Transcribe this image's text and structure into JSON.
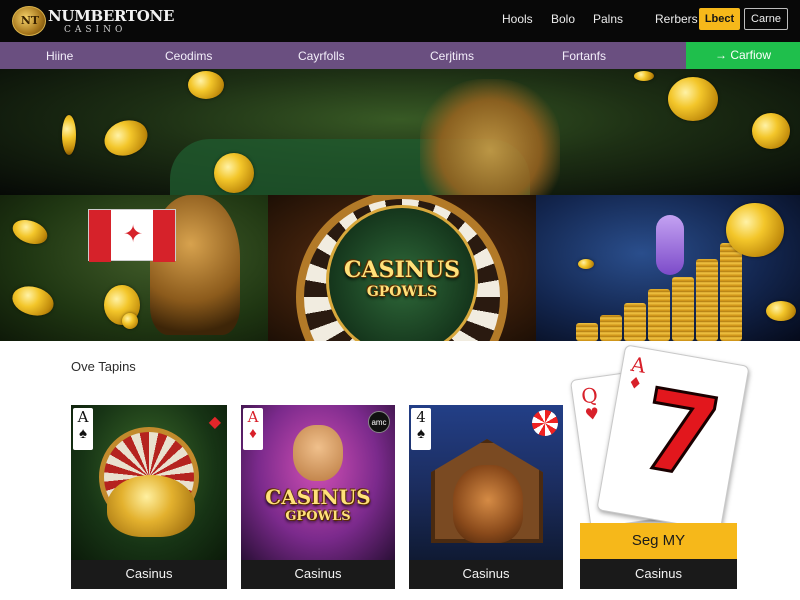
{
  "header": {
    "logo_name": "NUMBERTONE",
    "logo_sub": "CASINO",
    "logo_badge": "NT",
    "nav": [
      "Hools",
      "Bolo",
      "Palns",
      "Rerbers"
    ],
    "login_label": "Lbect",
    "casino_label": "Carne"
  },
  "mainnav": {
    "items": [
      "Hiine",
      "Ceodims",
      "Cayrfolls",
      "Cerjtims",
      "Fortanfs"
    ],
    "cta_label": "→ Carfiow"
  },
  "banners": {
    "center_logo_line1": "CASINUS",
    "center_logo_line2": "GPOWLS"
  },
  "section": {
    "title": "Ove Tapins"
  },
  "cards": [
    {
      "label": "Casinus",
      "corner_rank": "A",
      "corner_suit": "♠"
    },
    {
      "label": "Casinus",
      "corner_rank": "A",
      "corner_suit": "♦",
      "badge": "amc",
      "logo_line1": "CASINUS",
      "logo_line2": "GPOWLS"
    },
    {
      "label": "Casinus",
      "corner_rank": "4",
      "corner_suit": "♠"
    }
  ],
  "promo": {
    "back_rank": "Q",
    "back_suit": "♥",
    "front_rank": "A",
    "front_suit": "♦",
    "big_number": "7",
    "button_label": "Seg MY",
    "label": "Casinus"
  },
  "colors": {
    "topbar": "#080808",
    "mainnav": "#6a4f80",
    "cta_green": "#1fbf4c",
    "accent_yellow": "#f6b81a"
  }
}
